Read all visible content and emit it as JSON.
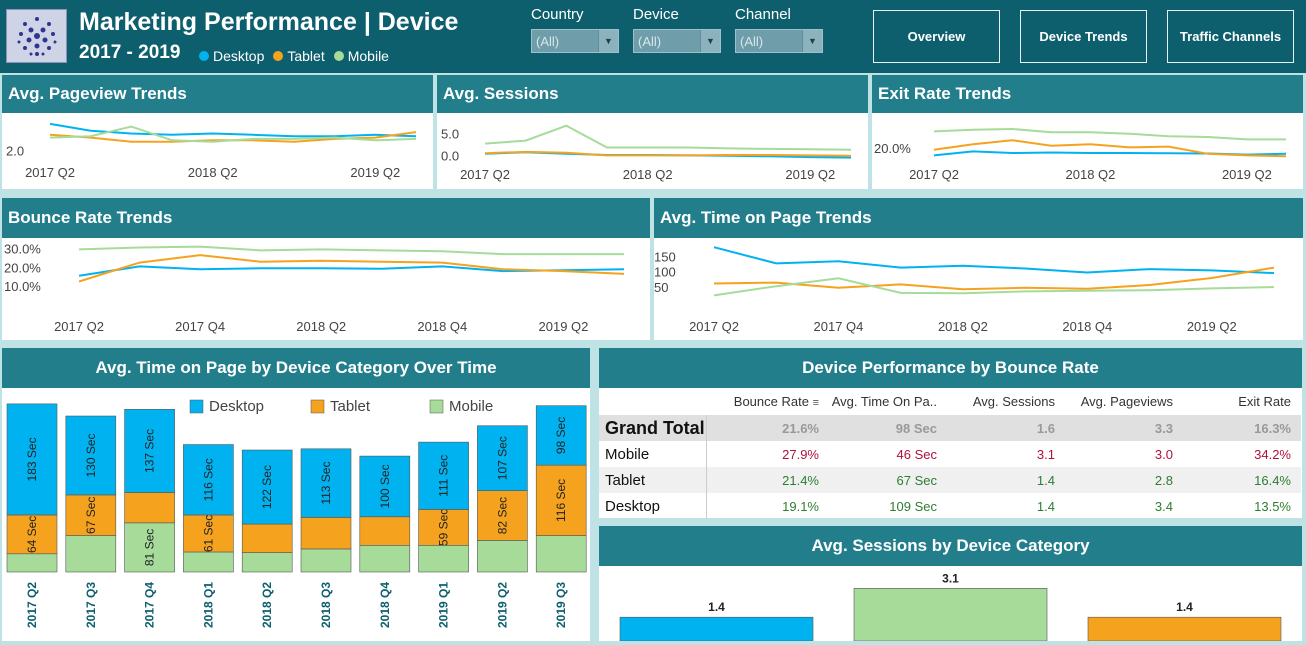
{
  "header": {
    "title": "Marketing Performance | Device",
    "years": "2017 - 2019",
    "legend": [
      {
        "label": "Desktop",
        "color": "#00b3f0"
      },
      {
        "label": "Tablet",
        "color": "#f5a21e"
      },
      {
        "label": "Mobile",
        "color": "#a6db9a"
      }
    ],
    "filters": [
      {
        "label": "Country",
        "value": "(All)"
      },
      {
        "label": "Device",
        "value": "(All)"
      },
      {
        "label": "Channel",
        "value": "(All)"
      }
    ],
    "nav": [
      "Overview",
      "Device Trends",
      "Traffic Channels"
    ]
  },
  "panels": {
    "pageview": {
      "title": "Avg. Pageview Trends"
    },
    "sessions": {
      "title": "Avg. Sessions"
    },
    "exit": {
      "title": "Exit Rate Trends"
    },
    "bounce": {
      "title": "Bounce Rate Trends"
    },
    "timeonpage": {
      "title": "Avg. Time on Page Trends"
    },
    "stacked": {
      "title": "Avg. Time on Page by Device Category Over Time"
    },
    "table": {
      "title": "Device Performance by Bounce Rate"
    },
    "sessbar": {
      "title": "Avg. Sessions by Device Category"
    }
  },
  "colors": {
    "desktop": "#00b3f0",
    "tablet": "#f5a21e",
    "mobile": "#a6db9a"
  },
  "chart_data": [
    {
      "type": "line",
      "title": "Avg. Pageview Trends",
      "x": [
        "2017 Q2",
        "2017 Q3",
        "2017 Q4",
        "2018 Q1",
        "2018 Q2",
        "2018 Q3",
        "2018 Q4",
        "2019 Q1",
        "2019 Q2",
        "2019 Q3"
      ],
      "xticks": [
        "2017 Q2",
        "2018 Q2",
        "2019 Q2"
      ],
      "yticks": [
        "2.0"
      ],
      "ylim": [
        1.0,
        4.5
      ],
      "series": [
        {
          "name": "Desktop",
          "values": [
            4.0,
            3.5,
            3.3,
            3.2,
            3.3,
            3.2,
            3.1,
            3.1,
            3.2,
            3.1
          ]
        },
        {
          "name": "Tablet",
          "values": [
            3.2,
            3.0,
            2.7,
            2.7,
            2.8,
            2.8,
            2.7,
            2.9,
            3.0,
            3.4
          ]
        },
        {
          "name": "Mobile",
          "values": [
            3.0,
            3.1,
            3.8,
            2.8,
            2.7,
            2.9,
            2.9,
            3.0,
            2.8,
            2.9
          ]
        }
      ]
    },
    {
      "type": "line",
      "title": "Avg. Sessions",
      "x": [
        "2017 Q2",
        "2017 Q3",
        "2017 Q4",
        "2018 Q1",
        "2018 Q2",
        "2018 Q3",
        "2018 Q4",
        "2019 Q1",
        "2019 Q2",
        "2019 Q3"
      ],
      "xticks": [
        "2017 Q2",
        "2018 Q2",
        "2019 Q2"
      ],
      "yticks": [
        "5.0",
        "0.0"
      ],
      "ylim": [
        -2,
        9
      ],
      "series": [
        {
          "name": "Desktop",
          "values": [
            0.6,
            0.9,
            0.6,
            0.3,
            0.3,
            0.2,
            0.1,
            0.0,
            -0.2,
            -0.3
          ]
        },
        {
          "name": "Tablet",
          "values": [
            0.7,
            1.0,
            0.8,
            0.2,
            0.2,
            0.2,
            0.3,
            0.3,
            0.2,
            0.1
          ]
        },
        {
          "name": "Mobile",
          "values": [
            2.9,
            3.6,
            7.0,
            2.0,
            2.0,
            2.0,
            1.8,
            1.7,
            1.6,
            1.5
          ]
        }
      ]
    },
    {
      "type": "line",
      "title": "Exit Rate Trends",
      "x": [
        "2017 Q2",
        "2017 Q3",
        "2017 Q4",
        "2018 Q1",
        "2018 Q2",
        "2018 Q3",
        "2018 Q4",
        "2019 Q1",
        "2019 Q2",
        "2019 Q3"
      ],
      "xticks": [
        "2017 Q2",
        "2018 Q2",
        "2019 Q2"
      ],
      "yticks": [
        "20.0%"
      ],
      "ylim": [
        10,
        40
      ],
      "series": [
        {
          "name": "Desktop",
          "values": [
            16.0,
            18.5,
            17.5,
            17.8,
            17.5,
            17.5,
            17.3,
            17.2,
            16.5,
            17.0
          ]
        },
        {
          "name": "Tablet",
          "values": [
            19.5,
            23.0,
            25.5,
            22.0,
            23.0,
            21.0,
            21.5,
            17.0,
            16.0,
            15.5
          ]
        },
        {
          "name": "Mobile",
          "values": [
            31.0,
            32.0,
            32.5,
            30.5,
            30.5,
            29.5,
            28.0,
            27.5,
            26.0,
            26.0
          ]
        }
      ]
    },
    {
      "type": "line",
      "title": "Bounce Rate Trends",
      "x": [
        "2017 Q2",
        "2017 Q3",
        "2017 Q4",
        "2018 Q1",
        "2018 Q2",
        "2018 Q3",
        "2018 Q4",
        "2019 Q1",
        "2019 Q2",
        "2019 Q3"
      ],
      "xticks": [
        "2017 Q2",
        "2017 Q4",
        "2018 Q2",
        "2018 Q4",
        "2019 Q2"
      ],
      "yticks": [
        "30.0%",
        "20.0%",
        "10.0%"
      ],
      "ylim": [
        0,
        35
      ],
      "series": [
        {
          "name": "Desktop",
          "values": [
            16.0,
            21.0,
            19.5,
            20.0,
            20.0,
            19.8,
            21.0,
            18.5,
            19.0,
            19.5
          ]
        },
        {
          "name": "Tablet",
          "values": [
            13.0,
            23.0,
            27.0,
            23.5,
            24.0,
            23.5,
            23.0,
            19.5,
            18.5,
            17.0
          ]
        },
        {
          "name": "Mobile",
          "values": [
            30.0,
            31.0,
            31.5,
            29.5,
            30.0,
            29.5,
            29.0,
            27.5,
            27.5,
            27.5
          ]
        }
      ]
    },
    {
      "type": "line",
      "title": "Avg. Time on Page Trends",
      "x": [
        "2017 Q2",
        "2017 Q3",
        "2017 Q4",
        "2018 Q1",
        "2018 Q2",
        "2018 Q3",
        "2018 Q4",
        "2019 Q1",
        "2019 Q2",
        "2019 Q3"
      ],
      "xticks": [
        "2017 Q2",
        "2017 Q4",
        "2018 Q2",
        "2018 Q4",
        "2019 Q2"
      ],
      "yticks": [
        "150",
        "100",
        "50"
      ],
      "ylim": [
        0,
        200
      ],
      "series": [
        {
          "name": "Desktop",
          "values": [
            183,
            130,
            137,
            116,
            122,
            113,
            100,
            111,
            107,
            98
          ]
        },
        {
          "name": "Tablet",
          "values": [
            64,
            67,
            50,
            61,
            45,
            50,
            47,
            59,
            82,
            116
          ]
        },
        {
          "name": "Mobile",
          "values": [
            25,
            55,
            81,
            33,
            32,
            38,
            40,
            42,
            48,
            52
          ]
        }
      ]
    },
    {
      "type": "bar",
      "stacked": true,
      "title": "Avg. Time on Page by Device Category Over Time",
      "categories": [
        "2017 Q2",
        "2017 Q3",
        "2017 Q4",
        "2018 Q1",
        "2018 Q2",
        "2018 Q3",
        "2018 Q4",
        "2019 Q1",
        "2019 Q2",
        "2019 Q3"
      ],
      "series": [
        {
          "name": "Mobile",
          "values": [
            30,
            60,
            81,
            33,
            32,
            38,
            44,
            44,
            52,
            60
          ]
        },
        {
          "name": "Tablet",
          "values": [
            64,
            67,
            50,
            61,
            47,
            52,
            47,
            59,
            82,
            116
          ]
        },
        {
          "name": "Desktop",
          "values": [
            183,
            130,
            137,
            116,
            122,
            113,
            100,
            111,
            107,
            98
          ]
        }
      ],
      "labels": {
        "Desktop": [
          "183 Sec",
          "130 Sec",
          "137 Sec",
          "116 Sec",
          "122 Sec",
          "113 Sec",
          "100 Sec",
          "111 Sec",
          "107 Sec",
          "98 Sec"
        ],
        "Tablet": [
          "64 Sec",
          "67 Sec",
          "",
          "61 Sec",
          "",
          "",
          "",
          "59 Sec",
          "82 Sec",
          "116 Sec"
        ],
        "Mobile": [
          "",
          "",
          "81 Sec",
          "",
          "",
          "",
          "",
          "",
          "",
          ""
        ]
      },
      "legend": [
        "Desktop",
        "Tablet",
        "Mobile"
      ]
    },
    {
      "type": "table",
      "title": "Device Performance by Bounce Rate",
      "columns": [
        "Bounce Rate",
        "Avg. Time On Pa..",
        "Avg. Sessions",
        "Avg. Pageviews",
        "Exit Rate"
      ],
      "rows": [
        {
          "name": "Grand Total",
          "values": [
            "21.6%",
            "98 Sec",
            "1.6",
            "3.3",
            "16.3%"
          ]
        },
        {
          "name": "Mobile",
          "values": [
            "27.9%",
            "46 Sec",
            "3.1",
            "3.0",
            "34.2%"
          ]
        },
        {
          "name": "Tablet",
          "values": [
            "21.4%",
            "67 Sec",
            "1.4",
            "2.8",
            "16.4%"
          ]
        },
        {
          "name": "Desktop",
          "values": [
            "19.1%",
            "109 Sec",
            "1.4",
            "3.4",
            "13.5%"
          ]
        }
      ]
    },
    {
      "type": "bar",
      "title": "Avg. Sessions by Device Category",
      "categories": [
        "Desktop",
        "Mobile",
        "Tablet"
      ],
      "values": [
        1.4,
        3.1,
        1.4
      ],
      "labels": [
        "1.4",
        "3.1",
        "1.4"
      ]
    }
  ]
}
